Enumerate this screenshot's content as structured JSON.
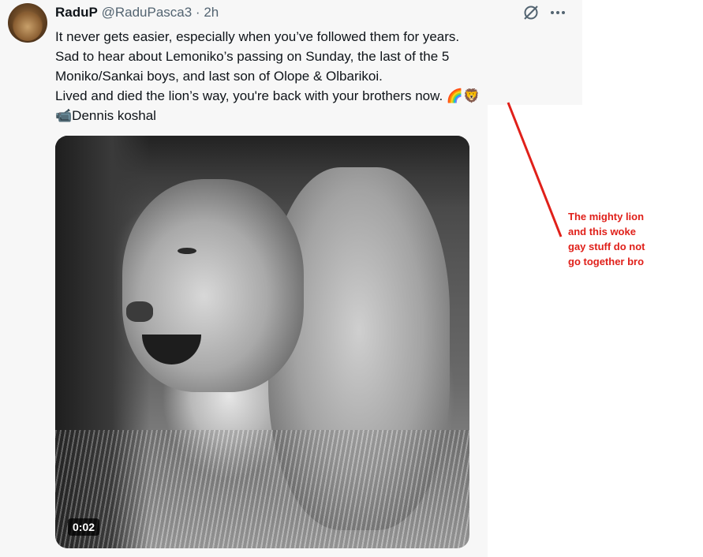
{
  "tweet": {
    "display_name": "RaduP",
    "handle": "@RaduPasca3",
    "separator": "·",
    "time": "2h",
    "lines": [
      "It never gets easier, especially when you’ve followed them for years.",
      "Sad to hear about Lemoniko’s passing on Sunday, the last of the 5",
      "Moniko/Sankai boys, and last son of Olope & Olbarikoi.",
      "Lived and died the lion’s way, you're back with your brothers now."
    ],
    "line4_emojis": "🌈🦁",
    "credit_icon": "📹",
    "credit_text": "Dennis koshal",
    "video_duration": "0:02"
  },
  "icons": {
    "avatar": "lion-avatar",
    "grok": "grok-icon",
    "more": "more-icon"
  },
  "annotation": {
    "lines": [
      "The mighty lion",
      "and this woke",
      "gay stuff do not",
      "go together bro"
    ],
    "color": "#e0201a"
  },
  "colors": {
    "background": "#f7f7f7",
    "text_primary": "#0f1419",
    "text_secondary": "#536471",
    "annotation_red": "#e0201a"
  }
}
